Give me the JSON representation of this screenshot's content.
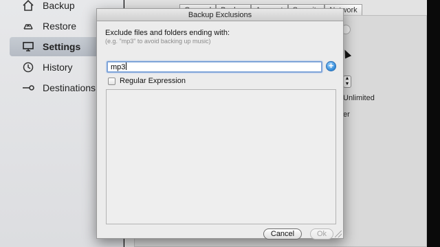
{
  "sidebar": {
    "items": [
      {
        "label": "Backup",
        "icon": "house-icon"
      },
      {
        "label": "Restore",
        "icon": "restore-icon"
      },
      {
        "label": "Settings",
        "icon": "monitor-icon",
        "selected": true
      },
      {
        "label": "History",
        "icon": "clock-icon"
      },
      {
        "label": "Destinations",
        "icon": "connector-icon"
      }
    ]
  },
  "background_window": {
    "tabs": [
      "General",
      "Backup",
      "Account",
      "Security",
      "Network"
    ],
    "text_unlimited": "Unlimited",
    "text_er": "er"
  },
  "dialog": {
    "title": "Backup Exclusions",
    "label": "Exclude files and folders ending with:",
    "hint": "(e.g. \"mp3\" to avoid backing up music)",
    "input_value": "mp3",
    "regex_label": "Regular Expression",
    "regex_checked": false,
    "cancel_label": "Cancel",
    "ok_label": "Ok",
    "add_symbol": "+"
  },
  "colors": {
    "accent": "#2f88d6",
    "focus_ring": "#7ea4d8",
    "selection": "#c0c6ce"
  }
}
